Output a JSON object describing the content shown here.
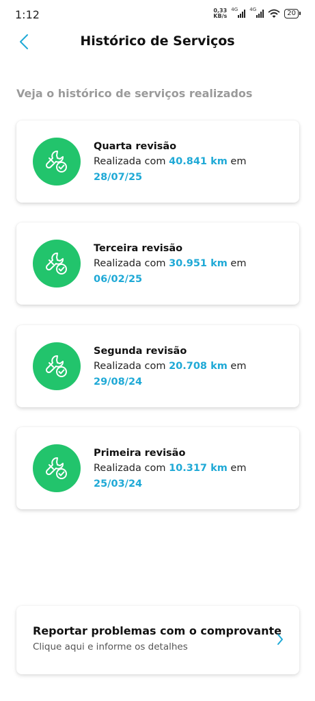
{
  "status_bar": {
    "time": "1:12",
    "net_speed_value": "0,33",
    "net_speed_unit": "KB/s",
    "network_1": "4G",
    "network_2": "4G",
    "battery": "20"
  },
  "header": {
    "title": "Histórico de Serviços",
    "back_icon": "chevron-left-icon"
  },
  "subtitle": "Veja o histórico de serviços realizados",
  "services": [
    {
      "title": "Quarta revisão",
      "prefix": "Realizada com ",
      "km": "40.841 km",
      "suffix": " em",
      "date": "28/07/25"
    },
    {
      "title": "Terceira revisão",
      "prefix": "Realizada com ",
      "km": "30.951 km",
      "suffix": " em",
      "date": "06/02/25"
    },
    {
      "title": "Segunda revisão",
      "prefix": "Realizada com ",
      "km": "20.708 km",
      "suffix": " em",
      "date": "29/08/24"
    },
    {
      "title": "Primeira revisão",
      "prefix": "Realizada com ",
      "km": "10.317 km",
      "suffix": " em",
      "date": "25/03/24"
    }
  ],
  "report": {
    "title": "Reportar problemas com o comprovante",
    "subtitle": "Clique aqui e informe os detalhes"
  },
  "colors": {
    "accent": "#1fa9d6",
    "icon_background": "#22c46c",
    "subtitle": "#9a9a9a"
  }
}
